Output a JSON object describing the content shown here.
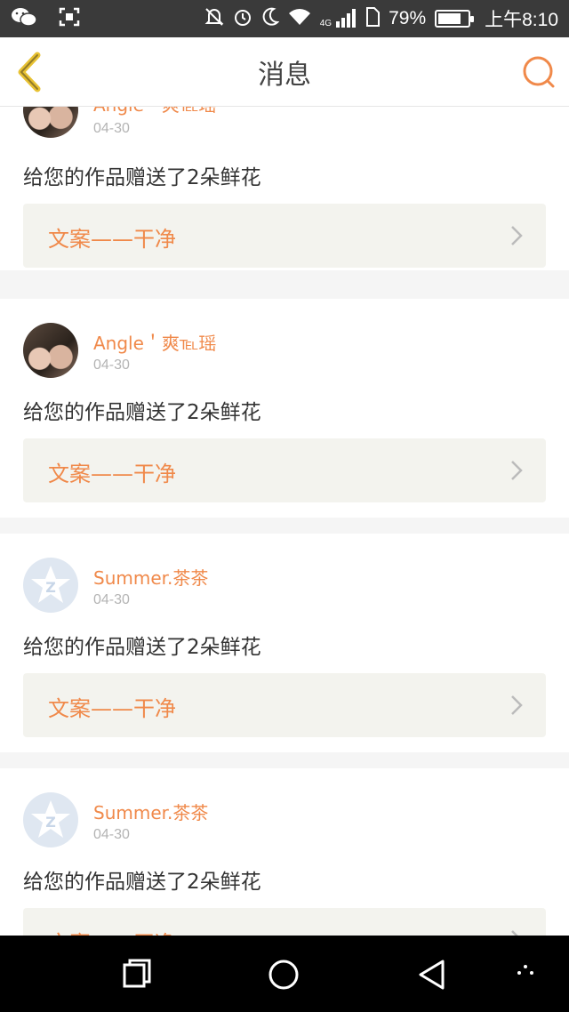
{
  "status_bar": {
    "battery_percent": "79%",
    "time": "上午8:10",
    "network": "4G",
    "battery_level": 0.79
  },
  "header": {
    "title": "消息"
  },
  "messages": [
    {
      "name": "Angle＇爽℡瑶",
      "date": "04-30",
      "text": "给您的作品赠送了2朵鲜花",
      "link": "文案——干净",
      "avatar": "photo"
    },
    {
      "name": "Angle＇爽℡瑶",
      "date": "04-30",
      "text": "给您的作品赠送了2朵鲜花",
      "link": "文案——干净",
      "avatar": "photo"
    },
    {
      "name": "Summer.茶茶",
      "date": "04-30",
      "text": "给您的作品赠送了2朵鲜花",
      "link": "文案——干净",
      "avatar": "default"
    },
    {
      "name": "Summer.茶茶",
      "date": "04-30",
      "text": "给您的作品赠送了2朵鲜花",
      "link": "文案——干净",
      "avatar": "default"
    }
  ],
  "colors": {
    "accent": "#f0894a",
    "back_icon": "#e8c233",
    "status_bar_bg": "#3a3a3a"
  },
  "icons": [
    "wechat-icon",
    "scan-icon",
    "mute-icon",
    "alarm-icon",
    "moon-icon",
    "wifi-icon",
    "signal-icon",
    "sim-icon",
    "battery-icon",
    "back-arrow-icon",
    "search-icon",
    "chevron-right-icon",
    "recent-apps-icon",
    "home-icon",
    "back-icon",
    "more-icon"
  ]
}
